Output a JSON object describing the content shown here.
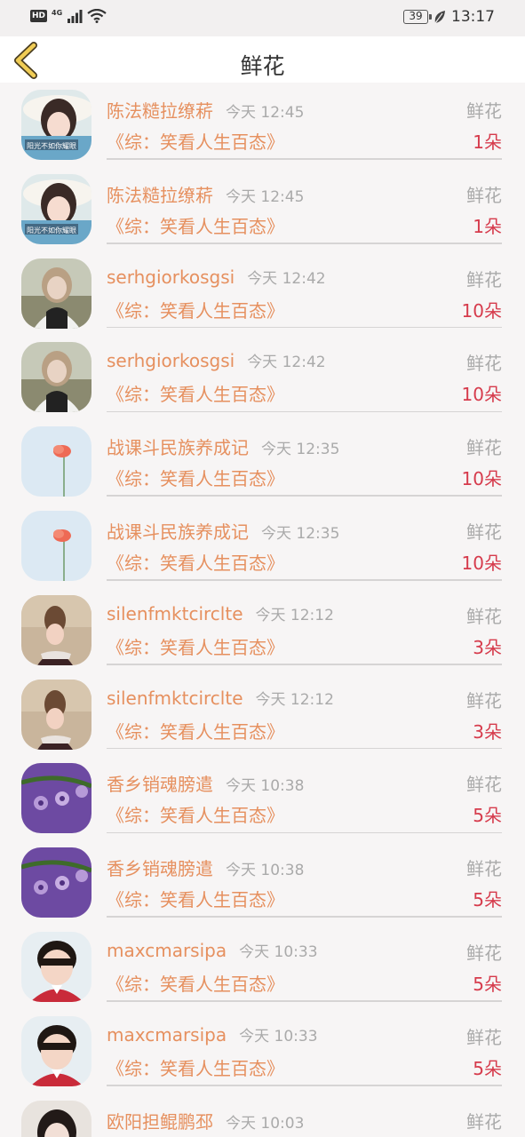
{
  "status_bar": {
    "hd_badge": "HD",
    "network": "4G",
    "battery_level": "39",
    "time": "13:17"
  },
  "header": {
    "title": "鲜花",
    "back_icon": "chevron-left-icon"
  },
  "colors": {
    "name": "#e6905f",
    "count": "#d63b4c",
    "meta": "#aaaaaa",
    "back_icon": "#e8c44a"
  },
  "records": [
    {
      "avatar": "girl-with-hat",
      "name": "陈法糙拉缭菥",
      "time": "今天 12:45",
      "type": "鲜花",
      "show": "《综：笑看人生百态》",
      "count": "1朵"
    },
    {
      "avatar": "girl-with-hat",
      "name": "陈法糙拉缭菥",
      "time": "今天 12:45",
      "type": "鲜花",
      "show": "《综：笑看人生百态》",
      "count": "1朵"
    },
    {
      "avatar": "girl-outdoors",
      "name": "serhgiorkosgsi",
      "time": "今天 12:42",
      "type": "鲜花",
      "show": "《综：笑看人生百态》",
      "count": "10朵"
    },
    {
      "avatar": "girl-outdoors",
      "name": "serhgiorkosgsi",
      "time": "今天 12:42",
      "type": "鲜花",
      "show": "《综：笑看人生百态》",
      "count": "10朵"
    },
    {
      "avatar": "red-poppy",
      "name": "战课斗民族养成记",
      "time": "今天 12:35",
      "type": "鲜花",
      "show": "《综：笑看人生百态》",
      "count": "10朵"
    },
    {
      "avatar": "red-poppy",
      "name": "战课斗民族养成记",
      "time": "今天 12:35",
      "type": "鲜花",
      "show": "《综：笑看人生百态》",
      "count": "10朵"
    },
    {
      "avatar": "girl-back-view",
      "name": "silenfmktcirclte",
      "time": "今天 12:12",
      "type": "鲜花",
      "show": "《综：笑看人生百态》",
      "count": "3朵"
    },
    {
      "avatar": "girl-back-view",
      "name": "silenfmktcirclte",
      "time": "今天 12:12",
      "type": "鲜花",
      "show": "《综：笑看人生百态》",
      "count": "3朵"
    },
    {
      "avatar": "purple-drops",
      "name": "香乡销魂膀遣",
      "time": "今天 10:38",
      "type": "鲜花",
      "show": "《综：笑看人生百态》",
      "count": "5朵"
    },
    {
      "avatar": "purple-drops",
      "name": "香乡销魂膀遣",
      "time": "今天 10:38",
      "type": "鲜花",
      "show": "《综：笑看人生百态》",
      "count": "5朵"
    },
    {
      "avatar": "little-boy",
      "name": "maxcmarsipa",
      "time": "今天 10:33",
      "type": "鲜花",
      "show": "《综：笑看人生百态》",
      "count": "5朵"
    },
    {
      "avatar": "little-boy",
      "name": "maxcmarsipa",
      "time": "今天 10:33",
      "type": "鲜花",
      "show": "《综：笑看人生百态》",
      "count": "5朵"
    },
    {
      "avatar": "girl-portrait",
      "name": "欧阳担鲲鹏邳",
      "time": "今天 10:03",
      "type": "鲜花",
      "show": "",
      "count": ""
    }
  ]
}
